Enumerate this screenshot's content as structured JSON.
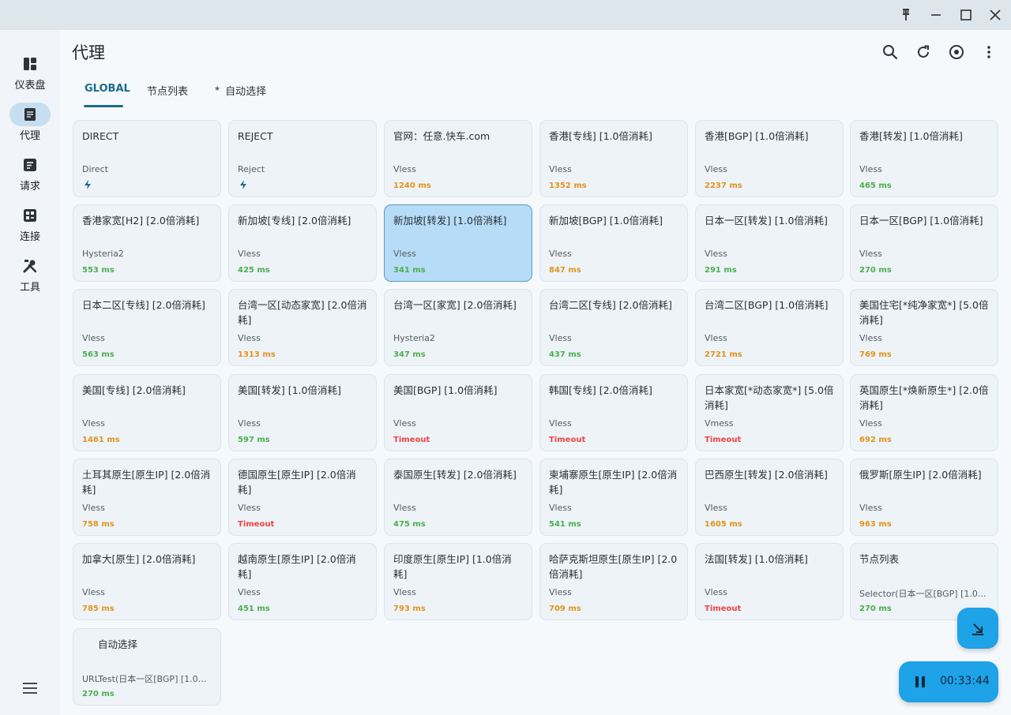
{
  "window": {
    "controls": [
      {
        "name": "pin-icon"
      },
      {
        "name": "minimize-icon"
      },
      {
        "name": "maximize-icon"
      },
      {
        "name": "close-icon"
      }
    ]
  },
  "sidebar": {
    "items": [
      {
        "label": "仪表盘",
        "icon": "dashboard-icon",
        "active": false
      },
      {
        "label": "代理",
        "icon": "proxy-icon",
        "active": true
      },
      {
        "label": "请求",
        "icon": "requests-icon",
        "active": false
      },
      {
        "label": "连接",
        "icon": "connections-icon",
        "active": false
      },
      {
        "label": "工具",
        "icon": "tools-icon",
        "active": false
      }
    ]
  },
  "header": {
    "title": "代理",
    "actions": [
      "search-icon",
      "refresh-icon",
      "target-icon",
      "more-vert-icon"
    ]
  },
  "tabs": [
    {
      "label": "GLOBAL",
      "active": true
    },
    {
      "label": "节点列表",
      "active": false
    },
    {
      "label": "自动选择",
      "active": false,
      "prefix": "★"
    }
  ],
  "proxies": [
    {
      "name": "DIRECT",
      "type": "Direct",
      "delay": "",
      "status": "bolt"
    },
    {
      "name": "REJECT",
      "type": "Reject",
      "delay": "",
      "status": "bolt"
    },
    {
      "name": "官网：任意.快车.com",
      "type": "Vless",
      "delay": "1240 ms",
      "status": "orange"
    },
    {
      "name": "香港[专线] [1.0倍消耗]",
      "type": "Vless",
      "delay": "1352 ms",
      "status": "orange"
    },
    {
      "name": "香港[BGP] [1.0倍消耗]",
      "type": "Vless",
      "delay": "2237 ms",
      "status": "orange"
    },
    {
      "name": "香港[转发] [1.0倍消耗]",
      "type": "Vless",
      "delay": "465 ms",
      "status": "green"
    },
    {
      "name": "香港家宽[H2] [2.0倍消耗]",
      "type": "Hysteria2",
      "delay": "553 ms",
      "status": "green"
    },
    {
      "name": "新加坡[专线] [2.0倍消耗]",
      "type": "Vless",
      "delay": "425 ms",
      "status": "green"
    },
    {
      "name": "新加坡[转发] [1.0倍消耗]",
      "type": "Vless",
      "delay": "341 ms",
      "status": "green",
      "selected": true
    },
    {
      "name": "新加坡[BGP] [1.0倍消耗]",
      "type": "Vless",
      "delay": "847 ms",
      "status": "orange"
    },
    {
      "name": "日本一区[转发] [1.0倍消耗]",
      "type": "Vless",
      "delay": "291 ms",
      "status": "green"
    },
    {
      "name": "日本一区[BGP] [1.0倍消耗]",
      "type": "Vless",
      "delay": "270 ms",
      "status": "green"
    },
    {
      "name": "日本二区[专线] [2.0倍消耗]",
      "type": "Vless",
      "delay": "563 ms",
      "status": "green"
    },
    {
      "name": "台湾一区[动态家宽] [2.0倍消耗]",
      "type": "Vless",
      "delay": "1313 ms",
      "status": "orange"
    },
    {
      "name": "台湾一区[家宽] [2.0倍消耗]",
      "type": "Hysteria2",
      "delay": "347 ms",
      "status": "green"
    },
    {
      "name": "台湾二区[专线] [2.0倍消耗]",
      "type": "Vless",
      "delay": "437 ms",
      "status": "green"
    },
    {
      "name": "台湾二区[BGP] [1.0倍消耗]",
      "type": "Vless",
      "delay": "2721 ms",
      "status": "orange"
    },
    {
      "name": "美国住宅[*纯净家宽*] [5.0倍消耗]",
      "type": "Vless",
      "delay": "769 ms",
      "status": "orange"
    },
    {
      "name": "美国[专线] [2.0倍消耗]",
      "type": "Vless",
      "delay": "1461 ms",
      "status": "orange"
    },
    {
      "name": "美国[转发] [1.0倍消耗]",
      "type": "Vless",
      "delay": "597 ms",
      "status": "green"
    },
    {
      "name": "美国[BGP] [1.0倍消耗]",
      "type": "Vless",
      "delay": "Timeout",
      "status": "red"
    },
    {
      "name": "韩国[专线] [2.0倍消耗]",
      "type": "Vless",
      "delay": "Timeout",
      "status": "red"
    },
    {
      "name": "日本家宽[*动态家宽*] [5.0倍消耗]",
      "type": "Vmess",
      "delay": "Timeout",
      "status": "red"
    },
    {
      "name": "英国原生[*焕新原生*] [2.0倍消耗]",
      "type": "Vless",
      "delay": "692 ms",
      "status": "orange"
    },
    {
      "name": "土耳其原生[原生IP] [2.0倍消耗]",
      "type": "Vless",
      "delay": "758 ms",
      "status": "orange"
    },
    {
      "name": "德国原生[原生IP] [2.0倍消耗]",
      "type": "Vless",
      "delay": "Timeout",
      "status": "red"
    },
    {
      "name": "泰国原生[转发] [2.0倍消耗]",
      "type": "Vless",
      "delay": "475 ms",
      "status": "green"
    },
    {
      "name": "柬埔寨原生[原生IP] [2.0倍消耗]",
      "type": "Vless",
      "delay": "541 ms",
      "status": "green"
    },
    {
      "name": "巴西原生[转发] [2.0倍消耗]",
      "type": "Vless",
      "delay": "1605 ms",
      "status": "orange"
    },
    {
      "name": "俄罗斯[原生IP] [2.0倍消耗]",
      "type": "Vless",
      "delay": "963 ms",
      "status": "orange"
    },
    {
      "name": "加拿大[原生] [2.0倍消耗]",
      "type": "Vless",
      "delay": "785 ms",
      "status": "orange"
    },
    {
      "name": "越南原生[原生IP] [2.0倍消耗]",
      "type": "Vless",
      "delay": "451 ms",
      "status": "green"
    },
    {
      "name": "印度原生[原生IP] [1.0倍消耗]",
      "type": "Vless",
      "delay": "793 ms",
      "status": "orange"
    },
    {
      "name": "哈萨克斯坦原生[原生IP] [2.0倍消耗]",
      "type": "Vless",
      "delay": "709 ms",
      "status": "orange"
    },
    {
      "name": "法国[转发] [1.0倍消耗]",
      "type": "Vless",
      "delay": "Timeout",
      "status": "red"
    },
    {
      "name": "节点列表",
      "type": "Selector(日本一区[BGP] [1.0...",
      "delay": "270 ms",
      "status": "green"
    },
    {
      "name": "自动选择",
      "type": "URLTest(日本一区[BGP] [1.0倍...",
      "delay": "270 ms",
      "status": "green",
      "indented": true
    }
  ],
  "fab": {
    "scroll_icon": "scroll-down-icon",
    "timer": "00:33:44",
    "pause_icon": "pause-icon"
  },
  "colors": {
    "accent": "#1b6c8a",
    "fab": "#1ea2e8",
    "delay_good": "#4caf50",
    "delay_medium": "#e0941f",
    "delay_timeout": "#ef4444",
    "selected_card": "#b6dcf7"
  }
}
